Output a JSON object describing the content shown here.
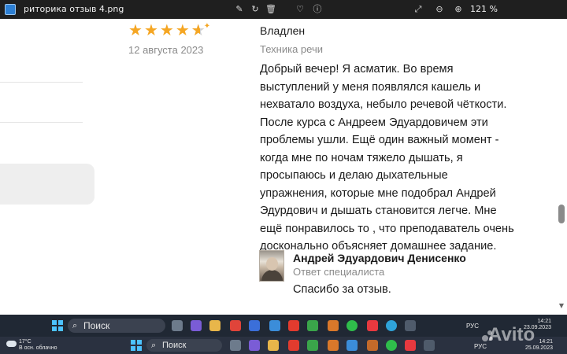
{
  "viewer": {
    "file_title": "риторика отзыв 4.png",
    "zoom_label": "121 %"
  },
  "review": {
    "rating": 4.5,
    "date": "12 августа 2023",
    "author": "Владлен",
    "category": "Техника речи",
    "text_lines": [
      "Добрый вечер! Я асматик. Во время",
      "выступлений у меня появлялся кашель и",
      "нехватало воздуха, небыло речевой чёткости.",
      "После курса с Андреем Эдуардовичем эти",
      "проблемы ушли. Ещё один важный момент -",
      "когда мне по ночам тяжело дышать, я",
      "просыпаюсь и делаю дыхательные",
      "упражнения, которые мне подобрал Андрей",
      "Эдурдович и дышать становится легче. Мне",
      "ещё понравилось то , что преподаватель очень",
      "досконально объясняет домашнее задание."
    ]
  },
  "reply": {
    "name": "Андрей Эдуардович Денисенко",
    "role": "Ответ специалиста",
    "text": "Спасибо за отзыв."
  },
  "taskbar_top": {
    "search_label": "Поиск",
    "lang": "РУС",
    "time": "14:21",
    "date": "23.09.2023"
  },
  "taskbar_bottom": {
    "weather_temp": "17°C",
    "weather_desc": "В осн. облачно",
    "search_label": "Поиск",
    "lang": "РУС",
    "time": "14:21",
    "date": "25.09.2023"
  },
  "watermark": "Avito",
  "colors": {
    "star": "#f5a623",
    "taskbar": "#202834",
    "accent": "#4cc2ff"
  }
}
